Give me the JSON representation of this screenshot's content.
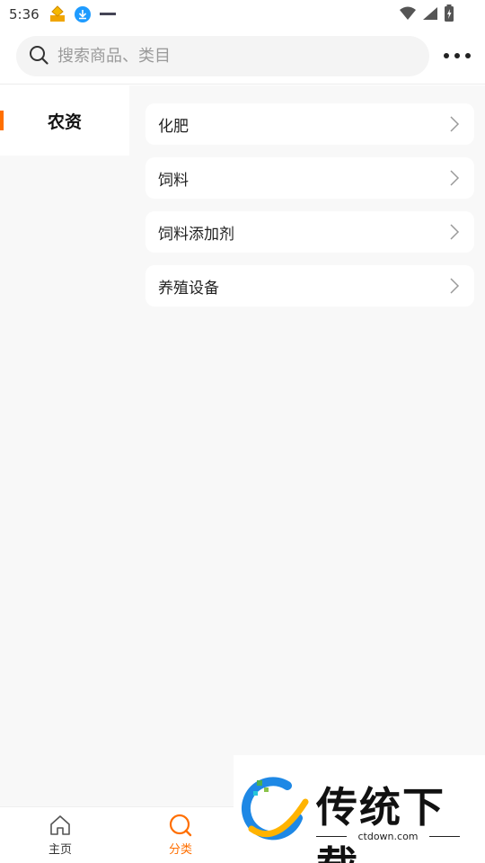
{
  "status_bar": {
    "time": "5:36",
    "icons": [
      "app-notification-icon",
      "download-icon",
      "app-small-icon",
      "wifi-icon",
      "signal-icon",
      "battery-icon"
    ]
  },
  "search": {
    "placeholder": "搜索商品、类目",
    "more_icon": "more-dots-icon"
  },
  "sidebar": {
    "items": [
      {
        "label": "农资",
        "selected": true
      }
    ]
  },
  "categories": [
    {
      "label": "化肥"
    },
    {
      "label": "饲料"
    },
    {
      "label": "饲料添加剂"
    },
    {
      "label": "养殖设备"
    }
  ],
  "bottom_nav": {
    "items": [
      {
        "label": "主页",
        "icon": "home-icon",
        "active": false
      },
      {
        "label": "分类",
        "icon": "search-category-icon",
        "active": true
      }
    ]
  },
  "watermark": {
    "text": "传统下载",
    "domain": "ctdown.com"
  },
  "colors": {
    "accent": "#ff6f00",
    "background": "#f8f8f8",
    "card": "#ffffff"
  }
}
